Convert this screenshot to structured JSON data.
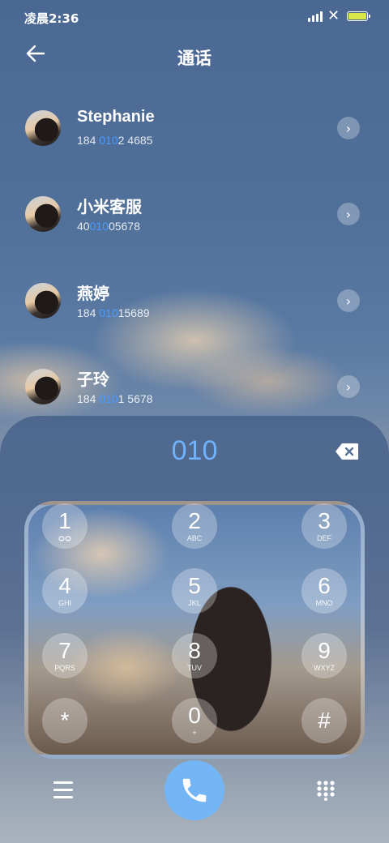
{
  "status_bar": {
    "time": "凌晨2:36",
    "icons": [
      "signal-icon",
      "network-x-icon",
      "battery-icon"
    ]
  },
  "header": {
    "title": "通话",
    "back_icon": "arrow-left-icon"
  },
  "contacts": [
    {
      "name": "Stephanie",
      "num_pre": "184 ",
      "num_hl": "010",
      "num_post": "2 4685"
    },
    {
      "name": "小米客服",
      "num_pre": "40",
      "num_hl": "010",
      "num_post": "05678"
    },
    {
      "name": "燕婷",
      "num_pre": "184 ",
      "num_hl": "010",
      "num_post": "15689"
    },
    {
      "name": "子玲",
      "num_pre": "184 ",
      "num_hl": "010",
      "num_post": "1 5678"
    }
  ],
  "dialer": {
    "number": "010",
    "keys": [
      {
        "digit": "1",
        "letters": ""
      },
      {
        "digit": "2",
        "letters": "ABC"
      },
      {
        "digit": "3",
        "letters": "DEF"
      },
      {
        "digit": "4",
        "letters": "GHI"
      },
      {
        "digit": "5",
        "letters": "JKL"
      },
      {
        "digit": "6",
        "letters": "MNO"
      },
      {
        "digit": "7",
        "letters": "PQRS"
      },
      {
        "digit": "8",
        "letters": "TUV"
      },
      {
        "digit": "9",
        "letters": "WXYZ"
      },
      {
        "digit": "*",
        "letters": ""
      },
      {
        "digit": "0",
        "letters": "+"
      },
      {
        "digit": "#",
        "letters": ""
      }
    ]
  },
  "colors": {
    "accent": "#4a9bff",
    "dial_number": "#6fb3ff",
    "call_button": "#74b6f5"
  }
}
